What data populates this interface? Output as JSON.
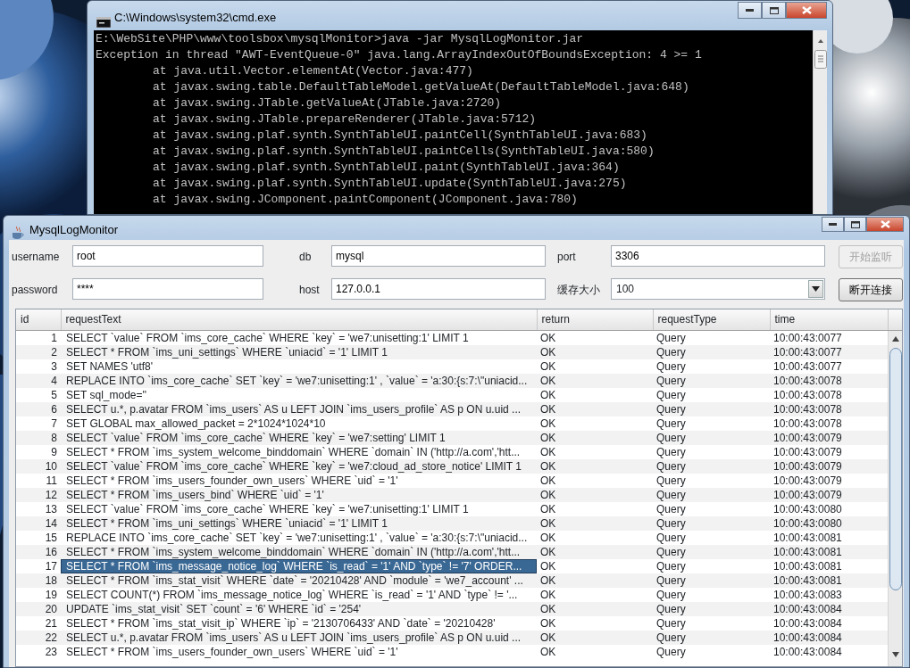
{
  "console_window": {
    "title": "C:\\Windows\\system32\\cmd.exe",
    "lines": [
      {
        "kind": "command",
        "text": "E:\\WebSite\\PHP\\www\\toolsbox\\mysqlMonitor>java -jar MysqlLogMonitor.jar"
      },
      {
        "kind": "exception",
        "text": "Exception in thread \"AWT-EventQueue-0\" java.lang.ArrayIndexOutOfBoundsException: 4 >= 1"
      },
      {
        "kind": "stack",
        "text": "at java.util.Vector.elementAt(Vector.java:477)"
      },
      {
        "kind": "stack",
        "text": "at javax.swing.table.DefaultTableModel.getValueAt(DefaultTableModel.java:648)"
      },
      {
        "kind": "stack",
        "text": "at javax.swing.JTable.getValueAt(JTable.java:2720)"
      },
      {
        "kind": "stack",
        "text": "at javax.swing.JTable.prepareRenderer(JTable.java:5712)"
      },
      {
        "kind": "stack",
        "text": "at javax.swing.plaf.synth.SynthTableUI.paintCell(SynthTableUI.java:683)"
      },
      {
        "kind": "stack",
        "text": "at javax.swing.plaf.synth.SynthTableUI.paintCells(SynthTableUI.java:580)"
      },
      {
        "kind": "stack",
        "text": "at javax.swing.plaf.synth.SynthTableUI.paint(SynthTableUI.java:364)"
      },
      {
        "kind": "stack",
        "text": "at javax.swing.plaf.synth.SynthTableUI.update(SynthTableUI.java:275)"
      },
      {
        "kind": "stack",
        "text": "at javax.swing.JComponent.paintComponent(JComponent.java:780)"
      }
    ]
  },
  "app_window": {
    "title": "MysqlLogMonitor",
    "form_rows": [
      {
        "fields": [
          {
            "label": "username",
            "value": "root",
            "kind": "text"
          },
          {
            "label": "db",
            "value": "mysql",
            "kind": "text"
          },
          {
            "label": "port",
            "value": "3306",
            "kind": "text"
          }
        ],
        "button": {
          "label": "开始监听",
          "disabled": true
        }
      },
      {
        "fields": [
          {
            "label": "password",
            "value": "****",
            "kind": "text"
          },
          {
            "label": "host",
            "value": "127.0.0.1",
            "kind": "text"
          },
          {
            "label": "缓存大小",
            "value": "100",
            "kind": "dropdown"
          }
        ],
        "button": {
          "label": "断开连接",
          "disabled": false
        }
      }
    ],
    "table": {
      "columns": [
        "id",
        "requestText",
        "return",
        "requestType",
        "time"
      ],
      "rows": [
        {
          "selected": false,
          "cells": [
            "1",
            "SELECT `value` FROM `ims_core_cache` WHERE `key` = 'we7:unisetting:1'  LIMIT 1",
            "OK",
            "Query",
            "10:00:43:0077"
          ]
        },
        {
          "selected": false,
          "cells": [
            "2",
            "SELECT * FROM `ims_uni_settings` WHERE `uniacid` = '1'  LIMIT 1",
            "OK",
            "Query",
            "10:00:43:0077"
          ]
        },
        {
          "selected": false,
          "cells": [
            "3",
            "SET NAMES 'utf8'",
            "OK",
            "Query",
            "10:00:43:0077"
          ]
        },
        {
          "selected": false,
          "cells": [
            "4",
            "REPLACE INTO `ims_core_cache` SET `key` = 'we7:unisetting:1' , `value` = 'a:30:{s:7:\\\"uniacid...",
            "OK",
            "Query",
            "10:00:43:0078"
          ]
        },
        {
          "selected": false,
          "cells": [
            "5",
            "SET sql_mode=''",
            "OK",
            "Query",
            "10:00:43:0078"
          ]
        },
        {
          "selected": false,
          "cells": [
            "6",
            "SELECT u.*, p.avatar FROM `ims_users` AS u LEFT JOIN `ims_users_profile` AS p ON u.uid ...",
            "OK",
            "Query",
            "10:00:43:0078"
          ]
        },
        {
          "selected": false,
          "cells": [
            "7",
            "SET GLOBAL max_allowed_packet = 2*1024*1024*10",
            "OK",
            "Query",
            "10:00:43:0078"
          ]
        },
        {
          "selected": false,
          "cells": [
            "8",
            "SELECT `value` FROM `ims_core_cache` WHERE `key` = 'we7:setting'  LIMIT 1",
            "OK",
            "Query",
            "10:00:43:0079"
          ]
        },
        {
          "selected": false,
          "cells": [
            "9",
            "SELECT * FROM `ims_system_welcome_binddomain` WHERE `domain` IN ('http://a.com','htt...",
            "OK",
            "Query",
            "10:00:43:0079"
          ]
        },
        {
          "selected": false,
          "cells": [
            "10",
            "SELECT `value` FROM `ims_core_cache` WHERE `key` = 'we7:cloud_ad_store_notice'  LIMIT 1",
            "OK",
            "Query",
            "10:00:43:0079"
          ]
        },
        {
          "selected": false,
          "cells": [
            "11",
            "SELECT * FROM `ims_users_founder_own_users`  WHERE `uid` = '1'",
            "OK",
            "Query",
            "10:00:43:0079"
          ]
        },
        {
          "selected": false,
          "cells": [
            "12",
            "SELECT * FROM `ims_users_bind` WHERE `uid` = '1'",
            "OK",
            "Query",
            "10:00:43:0079"
          ]
        },
        {
          "selected": false,
          "cells": [
            "13",
            "SELECT `value` FROM `ims_core_cache` WHERE `key` = 'we7:unisetting:1'  LIMIT 1",
            "OK",
            "Query",
            "10:00:43:0080"
          ]
        },
        {
          "selected": false,
          "cells": [
            "14",
            "SELECT * FROM `ims_uni_settings` WHERE `uniacid` = '1'  LIMIT 1",
            "OK",
            "Query",
            "10:00:43:0080"
          ]
        },
        {
          "selected": false,
          "cells": [
            "15",
            "REPLACE INTO `ims_core_cache` SET `key` = 'we7:unisetting:1' , `value` = 'a:30:{s:7:\\\"uniacid...",
            "OK",
            "Query",
            "10:00:43:0081"
          ]
        },
        {
          "selected": false,
          "cells": [
            "16",
            "SELECT * FROM `ims_system_welcome_binddomain` WHERE `domain` IN ('http://a.com','htt...",
            "OK",
            "Query",
            "10:00:43:0081"
          ]
        },
        {
          "selected": true,
          "cells": [
            "17",
            "SELECT * FROM `ims_message_notice_log`  WHERE `is_read` = '1' AND `type` != '7' ORDER...",
            "OK",
            "Query",
            "10:00:43:0081"
          ]
        },
        {
          "selected": false,
          "cells": [
            "18",
            "SELECT * FROM `ims_stat_visit`  WHERE `date` = '20210428' AND `module` = 'we7_account' ...",
            "OK",
            "Query",
            "10:00:43:0081"
          ]
        },
        {
          "selected": false,
          "cells": [
            "19",
            "SELECT COUNT(*) FROM `ims_message_notice_log`  WHERE `is_read` = '1' AND `type` != '...",
            "OK",
            "Query",
            "10:00:43:0083"
          ]
        },
        {
          "selected": false,
          "cells": [
            "20",
            "UPDATE `ims_stat_visit` SET `count` = '6' WHERE `id` = '254'",
            "OK",
            "Query",
            "10:00:43:0084"
          ]
        },
        {
          "selected": false,
          "cells": [
            "21",
            "SELECT * FROM `ims_stat_visit_ip`  WHERE `ip` = '2130706433' AND `date` = '20210428'",
            "OK",
            "Query",
            "10:00:43:0084"
          ]
        },
        {
          "selected": false,
          "cells": [
            "22",
            "SELECT u.*, p.avatar FROM `ims_users` AS u LEFT JOIN `ims_users_profile` AS p ON u.uid ...",
            "OK",
            "Query",
            "10:00:43:0084"
          ]
        },
        {
          "selected": false,
          "cells": [
            "23",
            "SELECT * FROM `ims_users_founder_own_users`  WHERE `uid` = '1'",
            "OK",
            "Query",
            "10:00:43:0084"
          ]
        }
      ]
    }
  }
}
